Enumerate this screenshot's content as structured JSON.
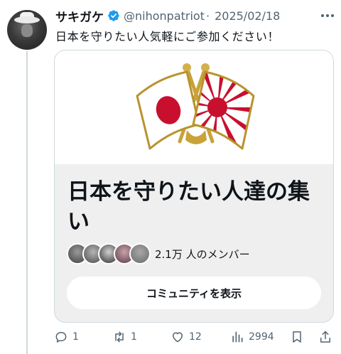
{
  "tweet": {
    "author": {
      "display_name": "サキガケ",
      "handle": "@nihonpatriot",
      "verified": true,
      "verified_color": "#1d9bf0"
    },
    "separator": "·",
    "date": "2025/02/18",
    "text": "日本を守りたい人気軽にご参加ください！",
    "avatar_icon": "avatar-image"
  },
  "community_card": {
    "image_icon": "crossed-japan-and-rising-sun-flags",
    "title": "日本を守りたい人達の集い",
    "member_count": "2.1万 人のメンバー",
    "button_label": "コミュニティを表示"
  },
  "actions": {
    "reply": {
      "icon": "reply-icon",
      "count": "1"
    },
    "retweet": {
      "icon": "retweet-icon",
      "count": "1"
    },
    "like": {
      "icon": "heart-icon",
      "count": "12"
    },
    "views": {
      "icon": "views-chart-icon",
      "count": "2994"
    },
    "bookmark": {
      "icon": "bookmark-icon"
    },
    "share": {
      "icon": "share-icon"
    }
  },
  "colors": {
    "text_primary": "#0f1419",
    "text_secondary": "#536471",
    "card_background": "#efefef",
    "border": "#cfd9de",
    "flag_red": "#c8102e"
  }
}
